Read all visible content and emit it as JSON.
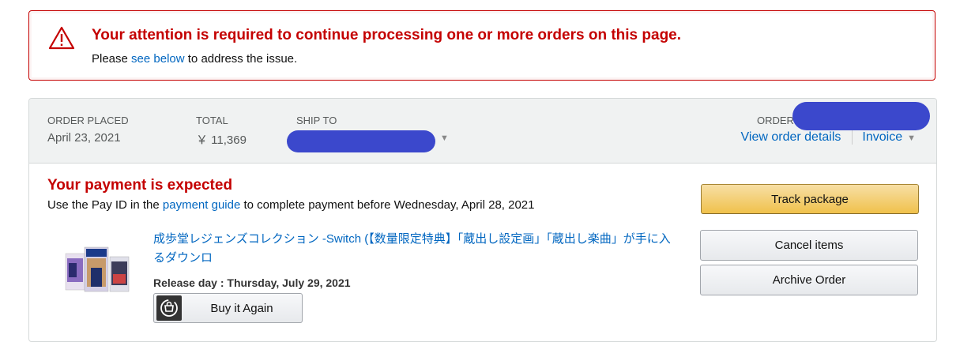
{
  "alert": {
    "title": "Your attention is required to continue processing one or more orders on this page.",
    "body_prefix": "Please ",
    "body_link": "see below",
    "body_suffix": " to address the issue."
  },
  "order": {
    "placed_label": "ORDER PLACED",
    "placed_value": "April 23, 2021",
    "total_label": "TOTAL",
    "total_value": "￥ 11,369",
    "ship_to_label": "SHIP TO",
    "order_number_label": "ORDER",
    "view_details_label": "View order details",
    "invoice_label": "Invoice"
  },
  "status": {
    "title": "Your payment is expected",
    "desc_prefix": "Use the Pay ID in the ",
    "desc_link": "payment guide",
    "desc_suffix": " to complete payment before Wednesday, April 28, 2021"
  },
  "product": {
    "title": "成歩堂レジェンズコレクション -Switch (【数量限定特典】「蔵出し設定画」「蔵出し楽曲」が手に入るダウンロ",
    "release": "Release day : Thursday, July 29, 2021",
    "buy_again_label": "Buy it Again"
  },
  "actions": {
    "track_label": "Track package",
    "cancel_label": "Cancel items",
    "archive_label": "Archive Order"
  },
  "colors": {
    "alert_red": "#c40000",
    "link_blue": "#0066c0",
    "track_yellow": "#f0c14b",
    "redaction": "#3b48cc"
  },
  "icons": {
    "alert": "warning-triangle-icon",
    "buy_again": "buy-again-icon",
    "dropdown": "chevron-down-icon"
  }
}
